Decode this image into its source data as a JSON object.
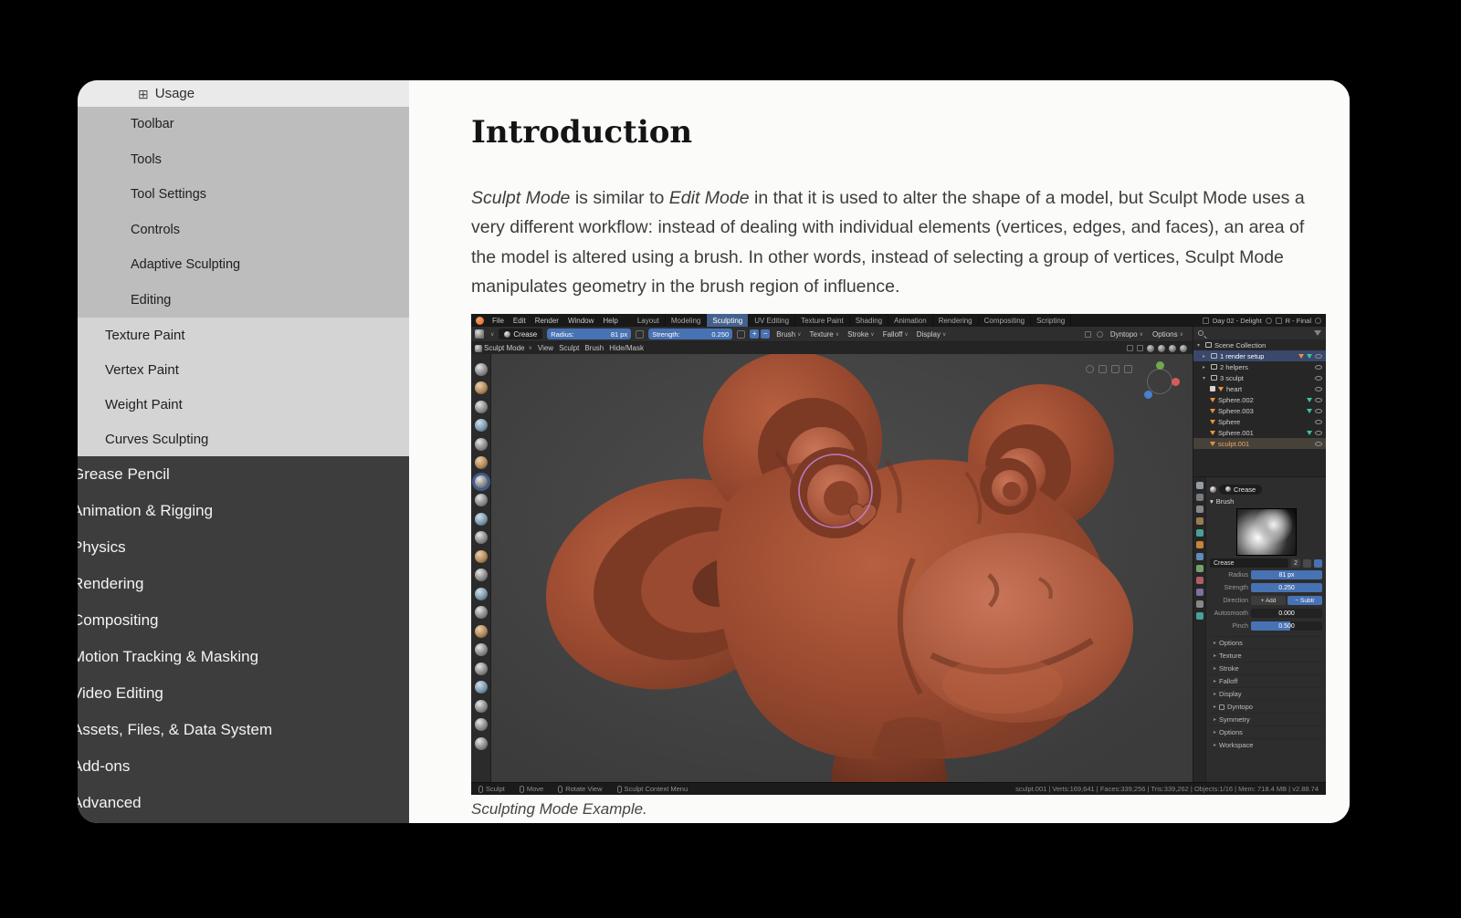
{
  "ui": {
    "caret": "∨",
    "arrow_down": "▾",
    "arrow_right": "▸",
    "expand_icon": "⊞",
    "plus": "+",
    "minus": "−"
  },
  "sidebar": {
    "usage_label": "Usage",
    "sub_items": [
      "Toolbar",
      "Tools",
      "Tool Settings",
      "Controls",
      "Adaptive Sculpting",
      "Editing"
    ],
    "mid_items": [
      "Texture Paint",
      "Vertex Paint",
      "Weight Paint",
      "Curves Sculpting"
    ],
    "dark_items": [
      "Grease Pencil",
      "Animation & Rigging",
      "Physics",
      "Rendering",
      "Compositing",
      "Motion Tracking & Masking",
      "Video Editing",
      "Assets, Files, & Data System",
      "Add-ons",
      "Advanced"
    ]
  },
  "article": {
    "title": "Introduction",
    "p1": {
      "i1": "Sculpt Mode",
      "t1": " is similar to ",
      "i2": "Edit Mode",
      "t2": " in that it is used to alter the shape of a model, but Sculpt Mode uses a very different workflow: instead of dealing with individual elements (vertices, edges, and faces), an area of the model is altered using a brush. In other words, instead of selecting a group of vertices, Sculpt Mode manipulates geometry in the brush region of influence."
    },
    "caption": "Sculpting Mode Example."
  },
  "blender": {
    "menus": [
      "File",
      "Edit",
      "Render",
      "Window",
      "Help"
    ],
    "tabs": [
      "Layout",
      "Modeling",
      "Sculpting",
      "UV Editing",
      "Texture Paint",
      "Shading",
      "Animation",
      "Rendering",
      "Compositing",
      "Scripting"
    ],
    "scene_name": "Day 02 - Delight",
    "view_layer": "R - Final",
    "tool_settings": {
      "brush_name": "Crease",
      "radius_label": "Radius:",
      "radius_value": "81 px",
      "strength_label": "Strength:",
      "strength_value": "0.250",
      "dropdowns": [
        "Brush",
        "Texture",
        "Stroke",
        "Falloff",
        "Display"
      ],
      "right_dropdowns": [
        "Dyntopo",
        "Options"
      ]
    },
    "viewport_header": {
      "mode": "Sculpt Mode",
      "menus": [
        "View",
        "Sculpt",
        "Brush",
        "Hide/Mask"
      ]
    },
    "outliner": {
      "title": "Scene Collection",
      "items": [
        "1 render setup",
        "2 helpers",
        "3 sculpt",
        "heart",
        "Sphere.002",
        "Sphere.003",
        "Sphere",
        "Sphere.001",
        "sculpt.001"
      ]
    },
    "properties": {
      "tool_name": "Crease",
      "section": "Brush",
      "preview_name": "Crease",
      "preview_count": "2",
      "radius_label": "Radius",
      "radius_value": "81 px",
      "strength_label": "Strength",
      "strength_value": "0.250",
      "direction_label": "Direction",
      "direction_add": "+ Add",
      "direction_subtr": "− Subtr",
      "autosmooth_label": "Autosmooth",
      "autosmooth_value": "0.000",
      "pinch_label": "Pinch",
      "pinch_value": "0.500",
      "collapsed": [
        "Options",
        "Texture",
        "Stroke",
        "Falloff",
        "Display",
        "Dyntopo",
        "Symmetry",
        "Options",
        "Workspace"
      ]
    },
    "statusbar": {
      "left": [
        "Sculpt",
        "Move",
        "Rotate View",
        "Sculpt Context Menu"
      ],
      "right": "sculpt.001 | Verts:169,641 | Faces:339,256 | Tris:339,262 | Objects:1/16 | Mem: 718.4 MB | v2.88.74"
    }
  }
}
